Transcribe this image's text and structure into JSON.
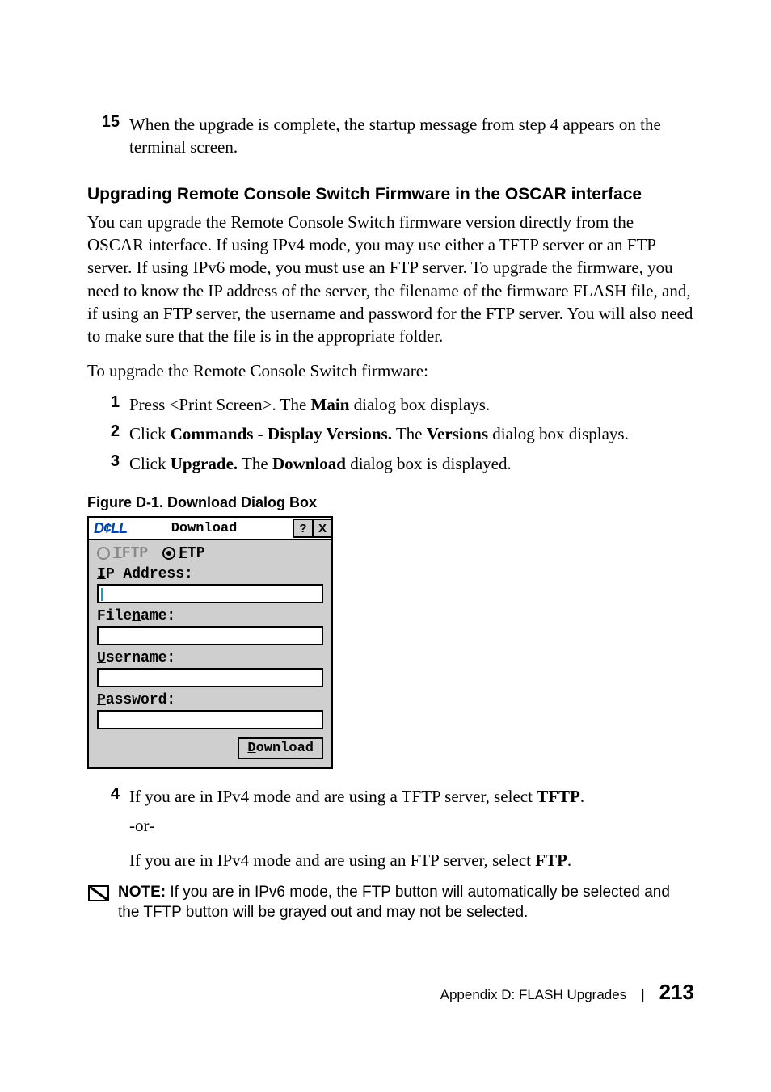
{
  "steps_top": {
    "num": "15",
    "text": "When the upgrade is complete, the startup message from step 4 appears on the terminal screen."
  },
  "heading1": "Upgrading Remote Console Switch Firmware in the OSCAR interface",
  "para1": "You can upgrade the Remote Console Switch firmware version directly from the OSCAR interface. If using IPv4 mode, you may use either a TFTP server or an FTP server. If using IPv6 mode, you must use an FTP server. To upgrade the firmware, you need to know the IP address of the server, the filename of the firmware FLASH file, and, if using an FTP server, the username and password for the FTP server. You will also need to make sure that the file is in the appropriate folder.",
  "para2": "To upgrade the Remote Console Switch firmware:",
  "sub_steps": [
    {
      "num": "1",
      "pre": "Press ",
      "code": "<Print Screen>.",
      "mid": " The ",
      "bold": "Main",
      "post": " dialog box displays."
    },
    {
      "num": "2",
      "pre": "Click ",
      "bold1": "Commands - Display Versions.",
      "mid": " The ",
      "bold2": "Versions",
      "post": " dialog box displays."
    },
    {
      "num": "3",
      "pre": "Click ",
      "bold1": "Upgrade.",
      "mid": " The ",
      "bold2": "Download",
      "post": " dialog box is displayed."
    }
  ],
  "figure_caption": "Figure D-1.    Download Dialog Box",
  "dialog": {
    "logo": "D¢LL",
    "title": "Download",
    "help": "?",
    "close": "X",
    "radio_tftp_u": "T",
    "radio_tftp_rest": "FTP",
    "radio_ftp_u": "F",
    "radio_ftp_rest": "TP",
    "ip_u": "I",
    "ip_rest": "P Address:",
    "file_pre": "File",
    "file_u": "n",
    "file_post": "ame:",
    "user_u": "U",
    "user_rest": "sername:",
    "pass_u": "P",
    "pass_rest": "assword:",
    "btn_u": "D",
    "btn_rest": "ownload"
  },
  "step4": {
    "num": "4",
    "line1_pre": "If you are in IPv4 mode and are using a TFTP server, select ",
    "line1_bold": "TFTP",
    "line1_post": ".",
    "or": "-or-",
    "line2_pre": "If you are in IPv4 mode and are using an FTP server, select ",
    "line2_bold": "FTP",
    "line2_post": "."
  },
  "note": {
    "label": "NOTE:",
    "text": " If you are in IPv6 mode, the FTP button will automatically be selected and the TFTP button will be grayed out and may not be selected."
  },
  "footer": {
    "text": "Appendix D: FLASH Upgrades",
    "page": "213"
  }
}
